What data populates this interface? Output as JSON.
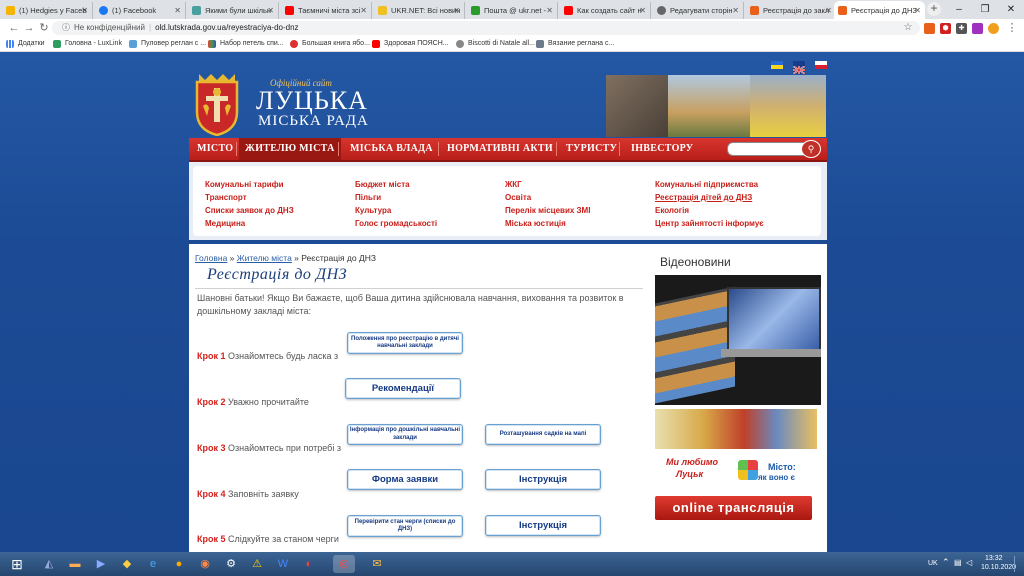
{
  "browser": {
    "tabs": [
      {
        "label": "(1) Hedgies у Faceb",
        "color": "#f4b400"
      },
      {
        "label": "(1) Facebook",
        "color": "#1877f2"
      },
      {
        "label": "Якими були шкільн",
        "color": "#4aa0a0"
      },
      {
        "label": "Таємничі міста зсі",
        "color": "#ff0000"
      },
      {
        "label": "UKR.NET: Всі новин",
        "color": "#f0c020"
      },
      {
        "label": "Пошта @ ukr.net - ",
        "color": "#2a9a2a"
      },
      {
        "label": "Как создать сайт н",
        "color": "#ff0000"
      },
      {
        "label": "Редагувати сторін",
        "color": "#666666"
      },
      {
        "label": "Реєстрація до закл",
        "color": "#e8601a"
      },
      {
        "label": "Реєстрація до ДНЗ",
        "color": "#e8601a"
      }
    ],
    "url_prefix": "Не конфіденційний",
    "url": "old.lutskrada.gov.ua/reyestraciya-do-dnz",
    "bookmarks": [
      "Додатки",
      "Головна - LuxLink",
      "Пуловер реглан с ...",
      "Набор петель спи...",
      "Большая книга ябо...",
      "Здоровая ПОЯСН...",
      "Biscotti di Natale all...",
      "Вязание реглана с..."
    ]
  },
  "site": {
    "official_label": "Офіційний сайт",
    "city": "ЛУЦЬКА",
    "council": "МІСЬКА РАДА",
    "menu": [
      "МІСТО",
      "ЖИТЕЛЮ МІСТА",
      "МІСЬКА ВЛАДА",
      "НОРМАТИВНІ АКТИ",
      "ТУРИСТУ",
      "ІНВЕСТОРУ"
    ],
    "submenu": {
      "col1": [
        "Комунальні тарифи",
        "Транспорт",
        "Списки заявок до ДНЗ",
        "Медицина"
      ],
      "col2": [
        "Бюджет міста",
        "Пільги",
        "Культура",
        "Голос громадськості"
      ],
      "col3": [
        "ЖКГ",
        "Освіта",
        "Перелік місцевих ЗМІ",
        "Міська юстиція"
      ],
      "col4": [
        "Комунальні підприємства",
        "Реєстрація дітей до ДНЗ",
        "Екологія",
        "Центр зайнятості інформує"
      ]
    }
  },
  "breadcrumb": {
    "home": "Головна",
    "sep1": " » ",
    "section": "Жителю міста",
    "sep2": " » ",
    "current": "Реєстрація до ДНЗ"
  },
  "page": {
    "title": "Реєстрація до ДНЗ",
    "intro": "Шановні батьки! Якщо Ви бажаєте, щоб Ваша дитина здійснювала навчання, виховання та розвиток в дошкільному закладі міста:",
    "steps": [
      {
        "num": "Крок 1",
        "text": " Ознайомтесь будь ласка з"
      },
      {
        "num": "Крок 2",
        "text": " Уважно прочитайте"
      },
      {
        "num": "Крок 3",
        "text": " Ознайомтесь при потребі з"
      },
      {
        "num": "Крок 4",
        "text": " Заповніть заявку"
      },
      {
        "num": "Крок 5",
        "text": "  Слідкуйте за станом черги"
      }
    ],
    "buttons": {
      "regulations": "Положення про реєстрацію в дитячі навчальні заклади",
      "recommendations": "Рекомендації",
      "info": "Інформація про дошкільні навчальні заклади",
      "map": "Розташування садків на мапі",
      "form": "Форма заявки",
      "instruction1": "Інструкція",
      "queue": "Перевірити стан черги (списки до ДНЗ)",
      "instruction2": "Інструкція"
    }
  },
  "sidebar": {
    "title": "Відеоновини",
    "love_line1": "Ми любимо",
    "love_line2": "Луцьк",
    "misto_line1": "Місто:",
    "misto_line2": "як воно є",
    "online": "online трансляція"
  },
  "taskbar": {
    "lang": "UK",
    "time": "13:32",
    "date": "10.10.2020"
  }
}
